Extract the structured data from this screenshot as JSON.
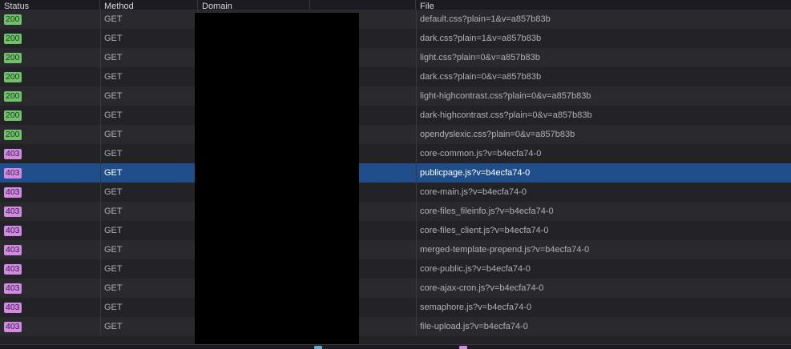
{
  "header": {
    "status": "Status",
    "method": "Method",
    "domain": "Domain",
    "file": "File"
  },
  "colors": {
    "ok_badge": "#6fc26b",
    "error_badge": "#d18be3",
    "selected_row": "#204e8a",
    "redaction": "#000000"
  },
  "requests": [
    {
      "status": "200",
      "method": "GET",
      "file": "default.css?plain=1&v=a857b83b"
    },
    {
      "status": "200",
      "method": "GET",
      "file": "dark.css?plain=1&v=a857b83b"
    },
    {
      "status": "200",
      "method": "GET",
      "file": "light.css?plain=0&v=a857b83b"
    },
    {
      "status": "200",
      "method": "GET",
      "file": "dark.css?plain=0&v=a857b83b"
    },
    {
      "status": "200",
      "method": "GET",
      "file": "light-highcontrast.css?plain=0&v=a857b83b"
    },
    {
      "status": "200",
      "method": "GET",
      "file": "dark-highcontrast.css?plain=0&v=a857b83b"
    },
    {
      "status": "200",
      "method": "GET",
      "file": "opendyslexic.css?plain=0&v=a857b83b"
    },
    {
      "status": "403",
      "method": "GET",
      "file": "core-common.js?v=b4ecfa74-0"
    },
    {
      "status": "403",
      "method": "GET",
      "file": "publicpage.js?v=b4ecfa74-0",
      "selected": true
    },
    {
      "status": "403",
      "method": "GET",
      "file": "core-main.js?v=b4ecfa74-0"
    },
    {
      "status": "403",
      "method": "GET",
      "file": "core-files_fileinfo.js?v=b4ecfa74-0"
    },
    {
      "status": "403",
      "method": "GET",
      "file": "core-files_client.js?v=b4ecfa74-0"
    },
    {
      "status": "403",
      "method": "GET",
      "file": "merged-template-prepend.js?v=b4ecfa74-0"
    },
    {
      "status": "403",
      "method": "GET",
      "file": "core-public.js?v=b4ecfa74-0"
    },
    {
      "status": "403",
      "method": "GET",
      "file": "core-ajax-cron.js?v=b4ecfa74-0"
    },
    {
      "status": "403",
      "method": "GET",
      "file": "semaphore.js?v=b4ecfa74-0"
    },
    {
      "status": "403",
      "method": "GET",
      "file": "file-upload.js?v=b4ecfa74-0"
    }
  ]
}
